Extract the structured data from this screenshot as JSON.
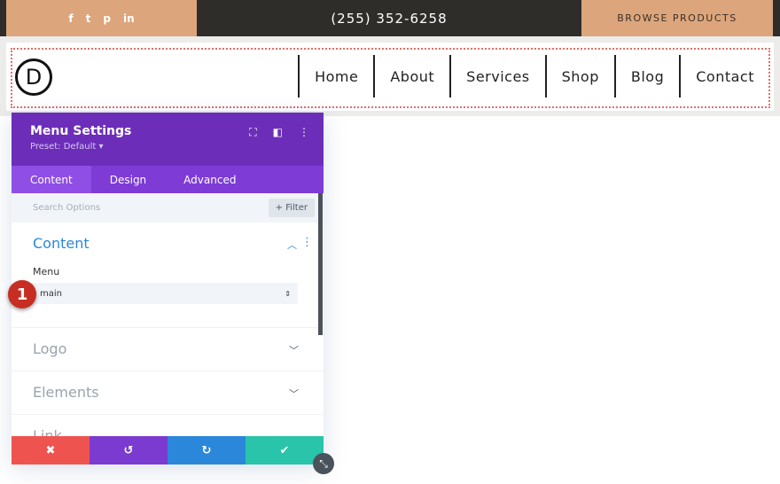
{
  "topbar": {
    "social": [
      "f",
      "t",
      "p",
      "in"
    ],
    "social_icons": [
      "facebook-icon",
      "twitter-icon",
      "pinterest-icon",
      "linkedin-icon"
    ],
    "phone": "(255) 352-6258",
    "cta": "BROWSE PRODUCTS"
  },
  "header": {
    "logo": "D",
    "nav": [
      "Home",
      "About",
      "Services",
      "Shop",
      "Blog",
      "Contact"
    ]
  },
  "panel": {
    "title": "Menu Settings",
    "preset": "Preset: Default ▾",
    "tabs": [
      "Content",
      "Design",
      "Advanced"
    ],
    "search_placeholder": "Search Options",
    "filter": "+ Filter",
    "content_section": "Content",
    "menu_label": "Menu",
    "menu_value": "main",
    "sections": [
      "Logo",
      "Elements",
      "Link"
    ]
  },
  "badge": "1",
  "colors": {
    "purple": "#6c2eb9",
    "tan": "#dca57b",
    "cancel": "#ef5350",
    "undo": "#7b3bd0",
    "redo": "#2b87da",
    "save": "#29c4a9"
  }
}
